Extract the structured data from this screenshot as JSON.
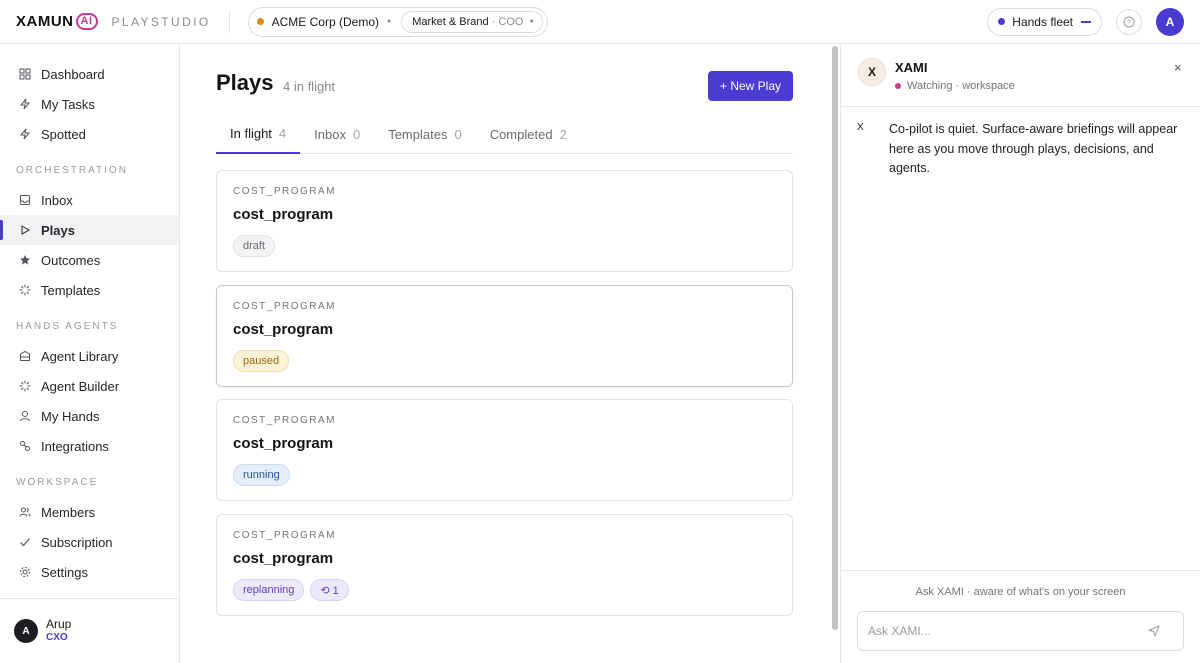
{
  "app": {
    "logo_text": "XAMUN",
    "logo_ai": "AI",
    "product": "PLAYSTUDIO"
  },
  "org": {
    "name": "ACME Corp (Demo)",
    "dot_color": "#e08a1e",
    "role": "Market & Brand",
    "role_sub": "· COO"
  },
  "fleet": {
    "label": "Hands fleet",
    "dot_color": "#4b3bd0"
  },
  "user": {
    "initial": "A",
    "name": "Arup",
    "role": "CXO"
  },
  "sidebar": {
    "top": [
      {
        "label": "Dashboard",
        "icon": "grid-icon"
      },
      {
        "label": "My Tasks",
        "icon": "bolt-icon"
      },
      {
        "label": "Spotted",
        "icon": "bolt-icon"
      }
    ],
    "sections": [
      {
        "title": "ORCHESTRATION",
        "items": [
          {
            "label": "Inbox",
            "icon": "inbox-icon"
          },
          {
            "label": "Plays",
            "icon": "play-icon",
            "active": true
          },
          {
            "label": "Outcomes",
            "icon": "star-icon"
          },
          {
            "label": "Templates",
            "icon": "spinner-icon"
          }
        ]
      },
      {
        "title": "HANDS AGENTS",
        "items": [
          {
            "label": "Agent Library",
            "icon": "library-icon"
          },
          {
            "label": "Agent Builder",
            "icon": "spinner-icon"
          },
          {
            "label": "My Hands",
            "icon": "user-icon"
          },
          {
            "label": "Integrations",
            "icon": "plug-icon"
          }
        ]
      },
      {
        "title": "WORKSPACE",
        "items": [
          {
            "label": "Members",
            "icon": "users-icon"
          },
          {
            "label": "Subscription",
            "icon": "check-icon"
          },
          {
            "label": "Settings",
            "icon": "gear-icon"
          }
        ]
      }
    ]
  },
  "main": {
    "title": "Plays",
    "subtitle": "4 in flight",
    "new_play": "+ New Play",
    "tabs": [
      {
        "label": "In flight",
        "count": "4",
        "active": true
      },
      {
        "label": "Inbox",
        "count": "0"
      },
      {
        "label": "Templates",
        "count": "0"
      },
      {
        "label": "Completed",
        "count": "2"
      }
    ],
    "plays": [
      {
        "kicker": "COST_PROGRAM",
        "title": "cost_program",
        "badges": [
          {
            "text": "draft",
            "bg": "#f3f3f4",
            "fg": "#6a6a73",
            "border": "#e2e2e6"
          }
        ]
      },
      {
        "kicker": "COST_PROGRAM",
        "title": "cost_program",
        "selected": true,
        "badges": [
          {
            "text": "paused",
            "bg": "#fdf3d6",
            "fg": "#9a6b12",
            "border": "#f0dda3"
          }
        ]
      },
      {
        "kicker": "COST_PROGRAM",
        "title": "cost_program",
        "badges": [
          {
            "text": "running",
            "bg": "#e4eefb",
            "fg": "#28558f",
            "border": "#c9dbf2"
          }
        ]
      },
      {
        "kicker": "COST_PROGRAM",
        "title": "cost_program",
        "badges": [
          {
            "text": "replanning",
            "bg": "#ede8fa",
            "fg": "#5a43b0",
            "border": "#d9d0f3"
          },
          {
            "text": "⟲ 1",
            "bg": "#ede8fa",
            "fg": "#5a43b0",
            "border": "#d9d0f3"
          }
        ]
      }
    ]
  },
  "copilot": {
    "avatar": "X",
    "name": "XAMI",
    "status": "Watching · workspace",
    "status_color": "#c83a8f",
    "close": "×",
    "message_avatar": "X",
    "message": "Co-pilot is quiet. Surface-aware briefings will appear here as you move through plays, decisions, and agents.",
    "hint": "Ask XAMI · aware of what's on your screen",
    "placeholder": "Ask XAMI..."
  }
}
